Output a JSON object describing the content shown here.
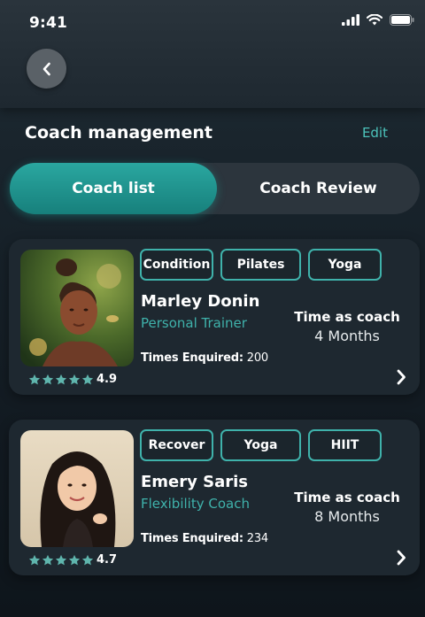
{
  "status_bar": {
    "time": "9:41"
  },
  "header": {
    "back_icon": "chevron-left-icon"
  },
  "section": {
    "title": "Coach management",
    "edit_label": "Edit"
  },
  "tabs": [
    {
      "label": "Coach list",
      "active": true
    },
    {
      "label": "Coach Review",
      "active": false
    }
  ],
  "coaches": [
    {
      "tags": [
        "Condition",
        "Pilates",
        "Yoga"
      ],
      "name": "Marley Donin",
      "role": "Personal Trainer",
      "enquired_label": "Times Enquired:",
      "enquired_value": "200",
      "time_label": "Time as coach",
      "time_value": "4 Months",
      "rating": "4.9",
      "stars": 5
    },
    {
      "tags": [
        "Recover",
        "Yoga",
        "HIIT"
      ],
      "name": "Emery Saris",
      "role": "Flexibility Coach",
      "enquired_label": "Times Enquired:",
      "enquired_value": "234",
      "time_label": "Time as coach",
      "time_value": "8 Months",
      "rating": "4.7",
      "stars": 5
    }
  ],
  "colors": {
    "accent": "#3fb2ab",
    "star": "#5fb5ad",
    "background": "#121a21"
  }
}
